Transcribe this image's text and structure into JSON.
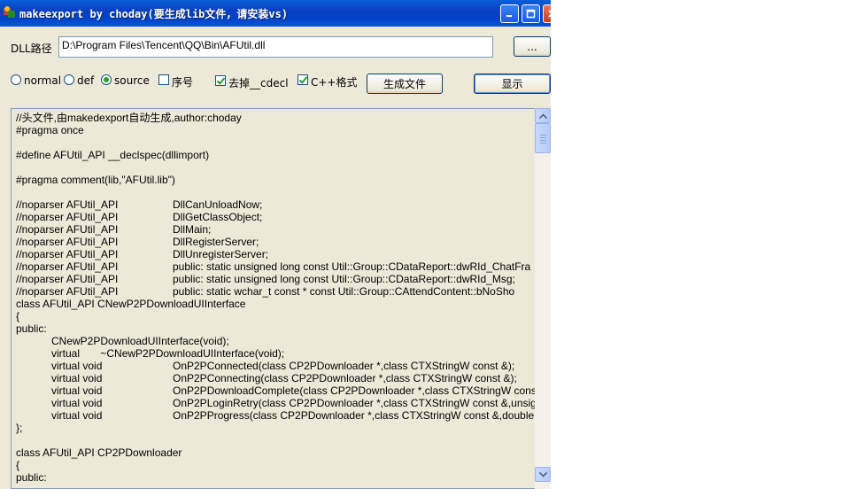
{
  "window": {
    "title": "makeexport by choday(要生成lib文件，请安装vs)"
  },
  "dll": {
    "label": "DLL路径",
    "path": "D:\\Program Files\\Tencent\\QQ\\Bin\\AFUtil.dll",
    "browse_label": "..."
  },
  "options": {
    "radios": [
      {
        "label": "normal",
        "checked": false
      },
      {
        "label": "def",
        "checked": false
      },
      {
        "label": "source",
        "checked": true
      }
    ],
    "checkboxes": [
      {
        "label": "序号",
        "checked": false
      },
      {
        "label": "去掉__cdecl",
        "checked": true
      },
      {
        "label": "C++格式",
        "checked": true
      }
    ],
    "generate_label": "生成文件",
    "show_label": "显示"
  },
  "code": {
    "lines": [
      [
        "//头文件,由makedexport自动生成,author:choday",
        ""
      ],
      [
        "#pragma once",
        ""
      ],
      [
        "",
        ""
      ],
      [
        "#define AFUtil_API __declspec(dllimport)",
        ""
      ],
      [
        "",
        ""
      ],
      [
        "#pragma comment(lib,\"AFUtil.lib\")",
        ""
      ],
      [
        "",
        ""
      ],
      [
        "//noparser AFUtil_API",
        "DllCanUnloadNow;"
      ],
      [
        "//noparser AFUtil_API",
        "DllGetClassObject;"
      ],
      [
        "//noparser AFUtil_API",
        "DllMain;"
      ],
      [
        "//noparser AFUtil_API",
        "DllRegisterServer;"
      ],
      [
        "//noparser AFUtil_API",
        "DllUnregisterServer;"
      ],
      [
        "//noparser AFUtil_API",
        "public: static unsigned long const Util::Group::CDataReport::dwRId_ChatFra"
      ],
      [
        "//noparser AFUtil_API",
        "public: static unsigned long const Util::Group::CDataReport::dwRId_Msg;"
      ],
      [
        "//noparser AFUtil_API",
        "public: static wchar_t const * const Util::Group::CAttendContent::bNoSho"
      ],
      [
        "class AFUtil_API CNewP2PDownloadUIInterface",
        ""
      ],
      [
        "{",
        ""
      ],
      [
        "public:",
        ""
      ],
      [
        "            CNewP2PDownloadUIInterface(void);",
        ""
      ],
      [
        "            virtual       ~CNewP2PDownloadUIInterface(void);",
        ""
      ],
      [
        "            virtual void",
        "OnP2PConnected(class CP2PDownloader *,class CTXStringW const &);"
      ],
      [
        "            virtual void",
        "OnP2PConnecting(class CP2PDownloader *,class CTXStringW const &);"
      ],
      [
        "            virtual void",
        "OnP2PDownloadComplete(class CP2PDownloader *,class CTXStringW const"
      ],
      [
        "            virtual void",
        "OnP2PLoginRetry(class CP2PDownloader *,class CTXStringW const &,unsign"
      ],
      [
        "            virtual void",
        "OnP2PProgress(class CP2PDownloader *,class CTXStringW const &,double,d"
      ],
      [
        "};",
        ""
      ],
      [
        "",
        ""
      ],
      [
        "class AFUtil_API CP2PDownloader",
        ""
      ],
      [
        "{",
        ""
      ],
      [
        "public:",
        ""
      ]
    ]
  },
  "icons": {
    "app": "app-icon",
    "minimize": "minimize-icon",
    "maximize": "maximize-icon",
    "close": "close-icon",
    "scroll_up": "arrow-up-icon",
    "scroll_down": "arrow-down-icon"
  }
}
